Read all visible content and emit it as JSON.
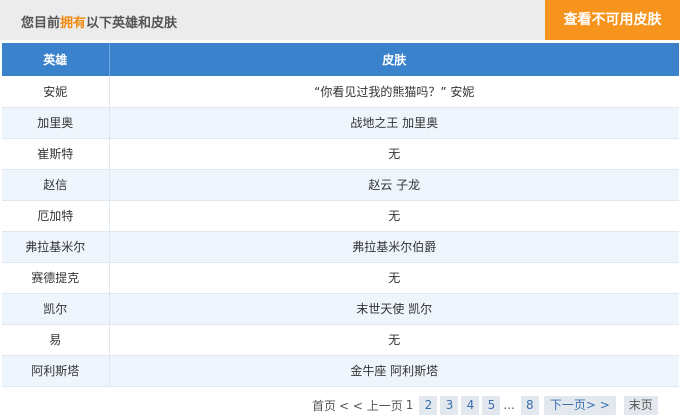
{
  "header": {
    "title_prefix": "您目前",
    "title_highlight": "拥有",
    "title_suffix": "以下英雄和皮肤",
    "unavailable_skins_button": "查看不可用皮肤"
  },
  "table": {
    "columns": [
      "英雄",
      "皮肤"
    ],
    "rows": [
      {
        "hero": "安妮",
        "skin": "“你看见过我的熊猫吗？” 安妮"
      },
      {
        "hero": "加里奥",
        "skin": "战地之王 加里奥"
      },
      {
        "hero": "崔斯特",
        "skin": "无"
      },
      {
        "hero": "赵信",
        "skin": "赵云 子龙"
      },
      {
        "hero": "厄加特",
        "skin": "无"
      },
      {
        "hero": "弗拉基米尔",
        "skin": "弗拉基米尔伯爵"
      },
      {
        "hero": "赛德提克",
        "skin": "无"
      },
      {
        "hero": "凯尔",
        "skin": "末世天使 凯尔"
      },
      {
        "hero": "易",
        "skin": "无"
      },
      {
        "hero": "阿利斯塔",
        "skin": "金牛座 阿利斯塔"
      }
    ]
  },
  "pagination": {
    "first": "首页",
    "prev": "< < 上一页",
    "current": "1",
    "pages": [
      "2",
      "3",
      "4",
      "5"
    ],
    "ellipsis": "...",
    "last_page_number": "8",
    "next": "下一页> >",
    "last": "末页"
  },
  "colors": {
    "header_bg": "#3a82cc",
    "accent_orange": "#f7941d",
    "highlight_text": "#f08c10",
    "row_alt": "#eef5fc"
  }
}
